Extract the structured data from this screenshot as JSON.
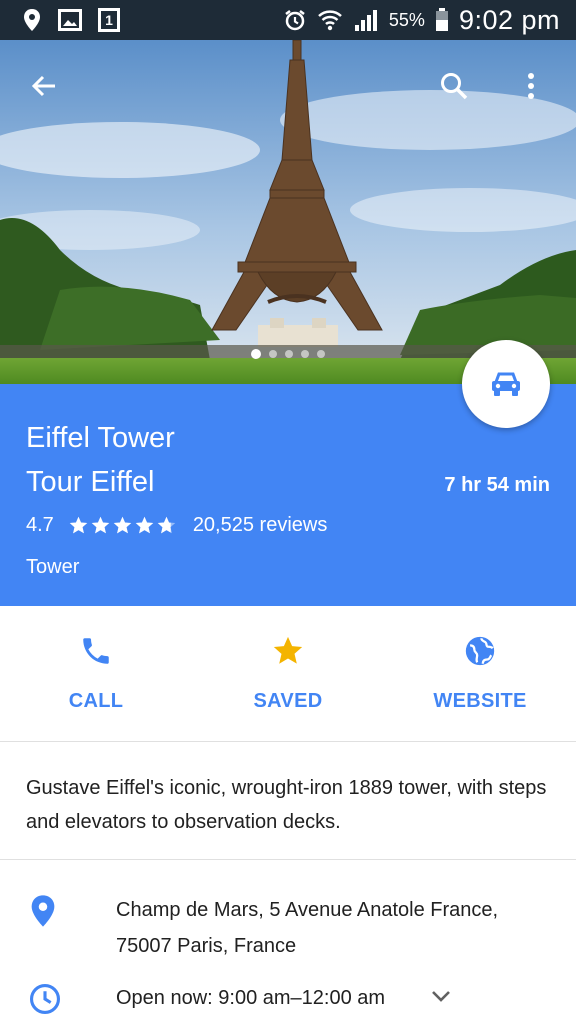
{
  "status_bar": {
    "battery": "55%",
    "time": "9:02 pm",
    "sim_badge": "1"
  },
  "place": {
    "name": "Eiffel Tower",
    "local_name": "Tour Eiffel",
    "rating": "4.7",
    "rating_value": 4.7,
    "reviews": "20,525 reviews",
    "category": "Tower",
    "drive_time": "7 hr 54 min"
  },
  "actions": [
    {
      "label": "CALL",
      "icon": "phone-icon"
    },
    {
      "label": "SAVED",
      "icon": "star-icon"
    },
    {
      "label": "WEBSITE",
      "icon": "globe-icon"
    }
  ],
  "description": "Gustave Eiffel's iconic, wrought-iron 1889 tower, with steps and elevators to observation decks.",
  "address": {
    "line1": "Champ de Mars, 5 Avenue Anatole France,",
    "line2": "75007 Paris, France"
  },
  "hours": "Open now: 9:00 am–12:00 am",
  "photo_pager": {
    "count": 5,
    "active": 0
  },
  "colors": {
    "accent": "#4285f4",
    "saved_star": "#f4b400",
    "status_bar": "#1e2b37"
  }
}
